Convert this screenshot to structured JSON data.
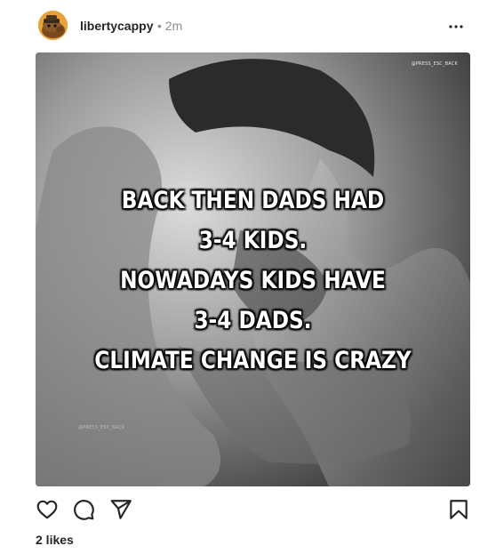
{
  "post": {
    "username": "libertycappy",
    "time": "• 2m",
    "image": {
      "watermark": "@PRESS_ESC_BACK",
      "lines": [
        "BACK THEN DADS HAD",
        "3-4 KIDS.",
        "NOWADAYS KIDS HAVE",
        "3-4 DADS.",
        "CLIMATE CHANGE IS CRAZY"
      ]
    },
    "likes": "2 likes"
  },
  "icons": {
    "more": "more-horizontal-icon",
    "like": "heart-icon",
    "comment": "comment-icon",
    "share": "paper-plane-icon",
    "save": "bookmark-icon"
  }
}
